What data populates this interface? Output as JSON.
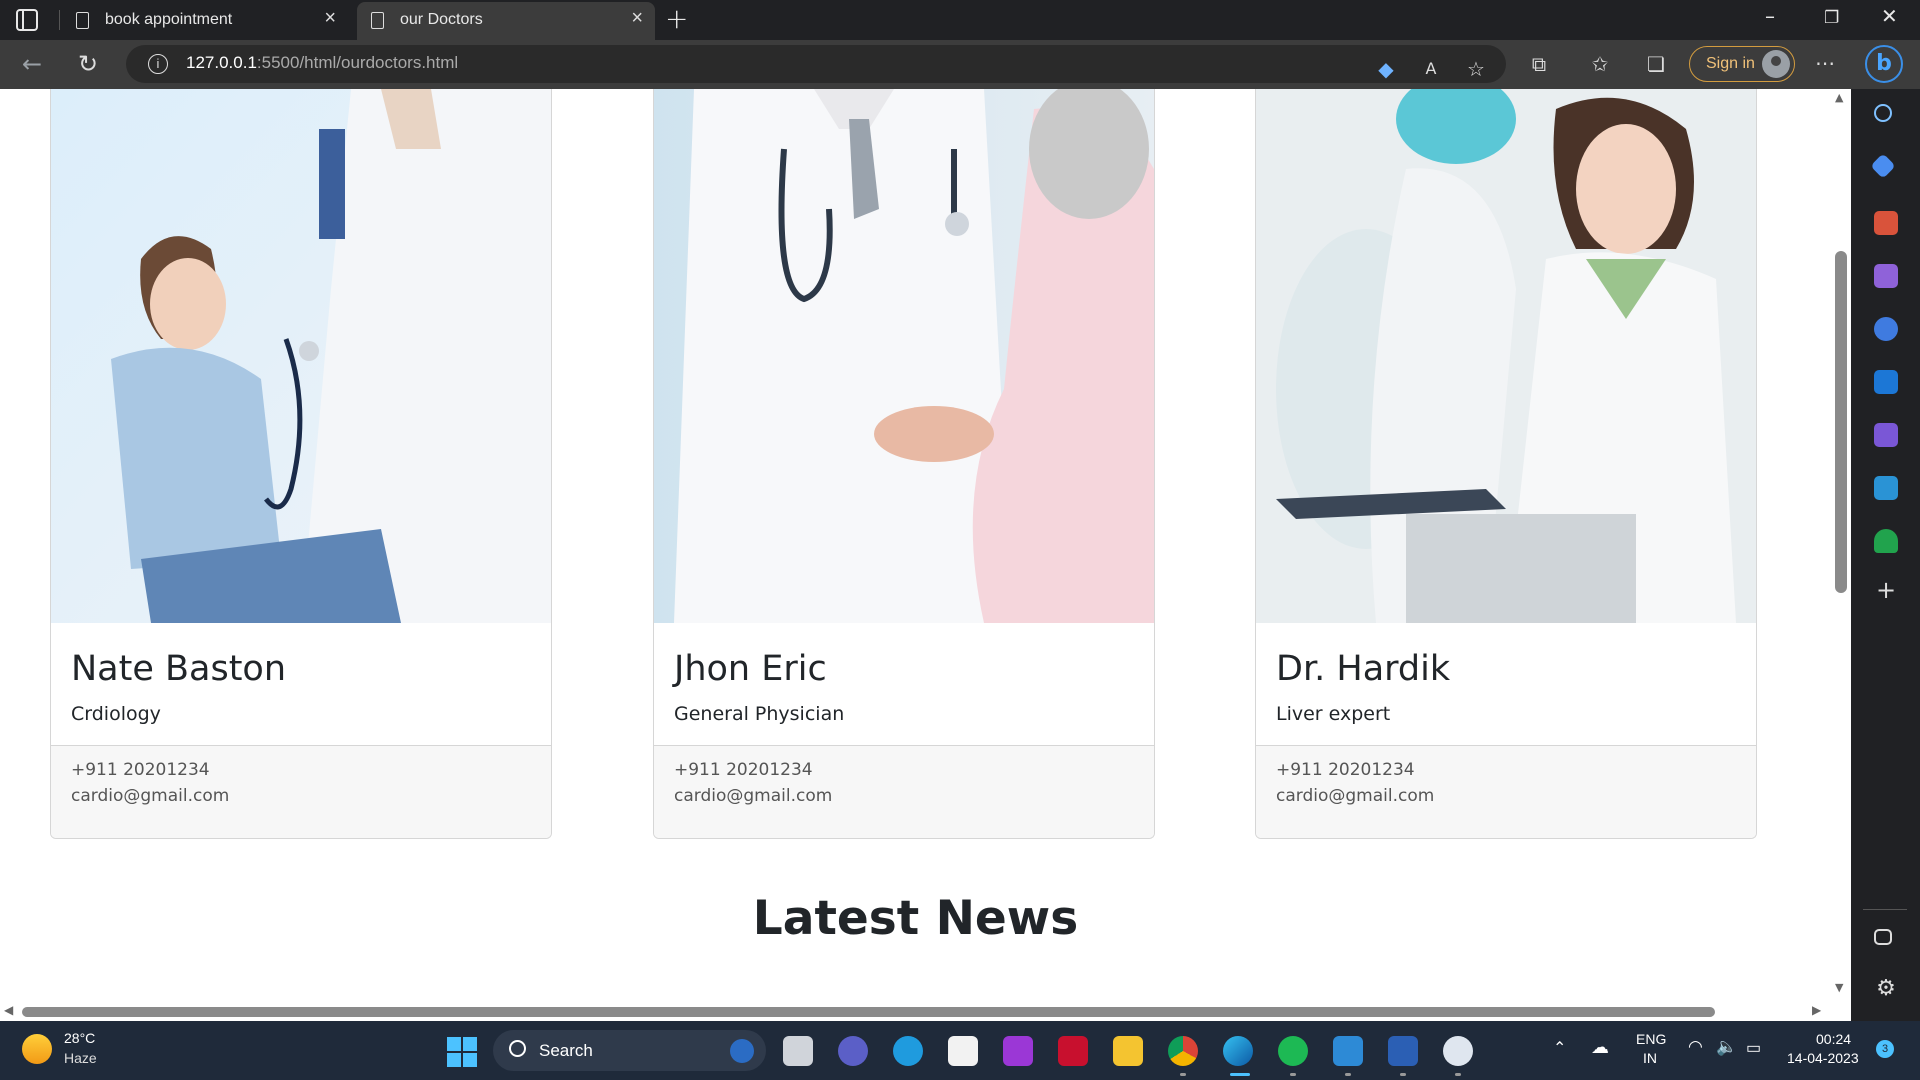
{
  "browser": {
    "tabs": [
      {
        "title": "book appointment",
        "active": false
      },
      {
        "title": "our Doctors",
        "active": true
      }
    ],
    "url_host": "127.0.0.1",
    "url_path": ":5500/html/ourdoctors.html",
    "signin_label": "Sign in"
  },
  "doctors": [
    {
      "name": "Nate Baston",
      "specialty": "Crdiology",
      "phone": "+911 20201234",
      "email": "cardio@gmail.com"
    },
    {
      "name": "Jhon Eric",
      "specialty": "General Physician",
      "phone": "+911 20201234",
      "email": "cardio@gmail.com"
    },
    {
      "name": "Dr. Hardik",
      "specialty": "Liver expert",
      "phone": "+911 20201234",
      "email": "cardio@gmail.com"
    }
  ],
  "section_title": "Latest News",
  "taskbar": {
    "weather_temp": "28°C",
    "weather_desc": "Haze",
    "search_label": "Search",
    "lang_1": "ENG",
    "lang_2": "IN",
    "time": "00:24",
    "date": "14-04-2023",
    "notif_count": "3"
  },
  "colors": {
    "chrome_dark": "#202124",
    "address_bar": "#3c3c3c",
    "taskbar": "#1f2a3a",
    "accent_signin": "#d39c3f",
    "text_dark": "#212529"
  }
}
